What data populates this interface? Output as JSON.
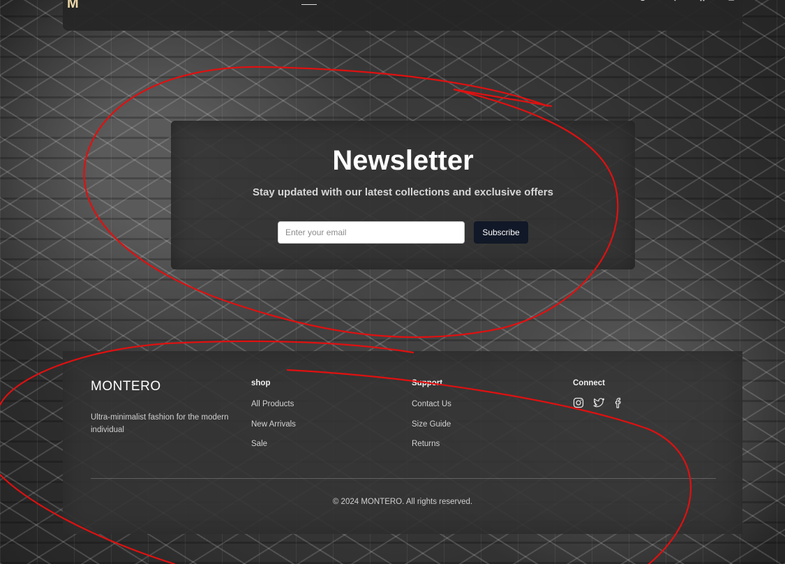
{
  "header": {
    "logo_mark": "M",
    "icons": [
      "globe-icon",
      "search-icon",
      "cart-icon",
      "user-icon"
    ]
  },
  "newsletter": {
    "title": "Newsletter",
    "subtitle": "Stay updated with our latest collections and exclusive offers",
    "email_placeholder": "Enter your email",
    "email_value": "",
    "subscribe_label": "Subscribe",
    "button_color": "#111827"
  },
  "footer": {
    "brand": {
      "name": "MONTERO",
      "tagline": "Ultra-minimalist fashion for the modern individual"
    },
    "columns": [
      {
        "heading": "shop",
        "links": [
          "All Products",
          "New Arrivals",
          "Sale"
        ]
      },
      {
        "heading": "Support",
        "links": [
          "Contact Us",
          "Size Guide",
          "Returns"
        ]
      }
    ],
    "connect": {
      "heading": "Connect",
      "icons": [
        "instagram-icon",
        "twitter-icon",
        "facebook-icon"
      ]
    },
    "copyright": "© 2024 MONTERO. All rights reserved."
  },
  "annotation": {
    "color": "#e01010"
  }
}
